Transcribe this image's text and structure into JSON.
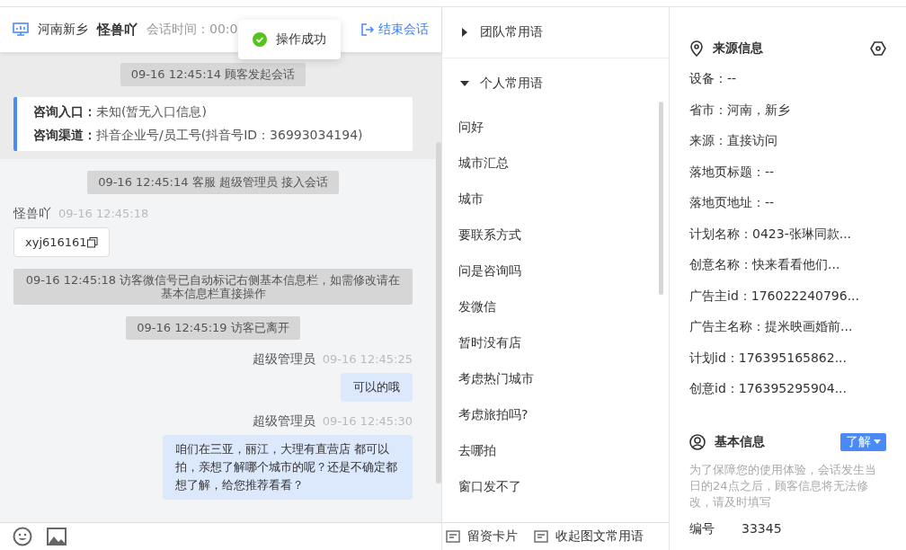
{
  "header": {
    "location": "河南新乡",
    "visitor": "怪兽吖",
    "session_time": "会话时间：00:0",
    "end_button": "结束会话"
  },
  "toast": {
    "text": "操作成功"
  },
  "messages": [
    {
      "kind": "system",
      "text": "09-16 12:45:14 顾客发起会话"
    },
    {
      "kind": "info",
      "rows": [
        {
          "label": "咨询入口：",
          "value": "未知(暂无入口信息)"
        },
        {
          "label": "咨询渠道：",
          "value": "抖音企业号/员工号(抖音号ID：36993034194)"
        }
      ]
    },
    {
      "kind": "system",
      "text": "09-16 12:45:14 客服 超级管理员 接入会话"
    },
    {
      "kind": "visitor",
      "sender": "怪兽吖",
      "time": "09-16 12:45:18",
      "text": "xyj616161"
    },
    {
      "kind": "system",
      "text": "09-16 12:45:18 访客微信号已自动标记右侧基本信息栏，如需修改请在基本信息栏直接操作"
    },
    {
      "kind": "system",
      "text": "09-16 12:45:19 访客已离开"
    },
    {
      "kind": "agent",
      "sender": "超级管理员",
      "time": "09-16 12:45:25",
      "text": "可以的哦"
    },
    {
      "kind": "agent",
      "sender": "超级管理员",
      "time": "09-16 12:45:30",
      "text": "咱们在三亚，丽江，大理有直营店 都可以拍，亲想了解哪个城市的呢？还是不确定都想了解，给您推荐看看？"
    }
  ],
  "phrase_groups": [
    {
      "title": "团队常用语",
      "expanded": false
    },
    {
      "title": "个人常用语",
      "expanded": true,
      "items": [
        "问好",
        "城市汇总",
        "城市",
        "要联系方式",
        "问是咨询吗",
        "发微信",
        "暂时没有店",
        "考虑热门城市",
        "考虑旅拍吗?",
        "去哪拍",
        "窗口发不了"
      ]
    }
  ],
  "phrase_footer": [
    "留资卡片",
    "收起图文常用语"
  ],
  "source_info": {
    "title": "来源信息",
    "fields": [
      "设备：--",
      "省市：河南，新乡",
      "来源：直接访问",
      "落地页标题：--",
      "落地页地址：--",
      "计划名称：0423-张琳同款...",
      "创意名称：快来看看他们...",
      "广告主id：176022240796...",
      "广告主名称：提米映画婚前...",
      "计划id：176395165862...",
      "创意id：176395295904..."
    ]
  },
  "basic_info": {
    "title": "基本信息",
    "dropdown": "了解",
    "note": "为了保障您的使用体验，会话发生当日的24点之后，顾客信息将无法修改，请及时填写",
    "fields": [
      {
        "label": "编号",
        "value": "33345"
      }
    ]
  }
}
